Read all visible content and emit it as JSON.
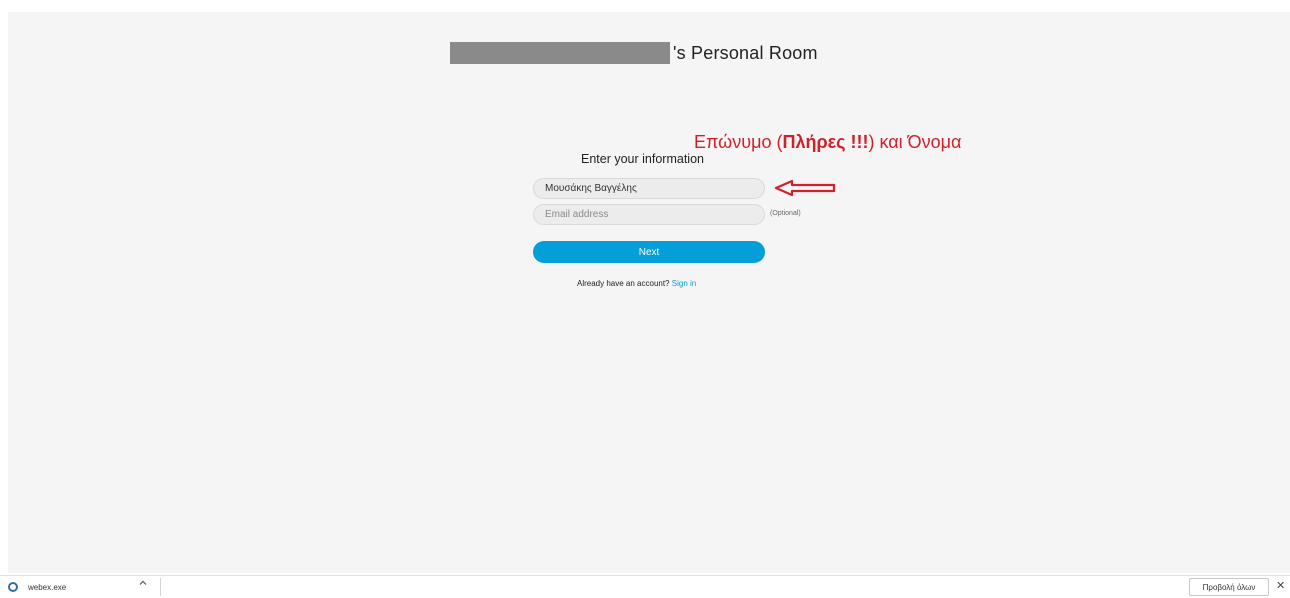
{
  "room": {
    "title_suffix": "'s Personal Room"
  },
  "annotation": {
    "prefix": "Επώνυμο (",
    "bold": "Πλήρες !!!",
    "suffix": ") και  Όνομα",
    "color": "#d0212b"
  },
  "form": {
    "heading": "Enter your information",
    "name_value": "Μουσάκης Βαγγέλης",
    "email_placeholder": "Email address",
    "optional_label": "(Optional)",
    "next_label": "Next",
    "account_prompt": "Already have an account?",
    "sign_in_label": "Sign in",
    "accent_color": "#049fd9"
  },
  "download_bar": {
    "file_name": "webex.exe",
    "chevron": "^",
    "show_all_label": "Προβολή όλων",
    "close_label": "✕",
    "file_icon": "webex-icon"
  }
}
